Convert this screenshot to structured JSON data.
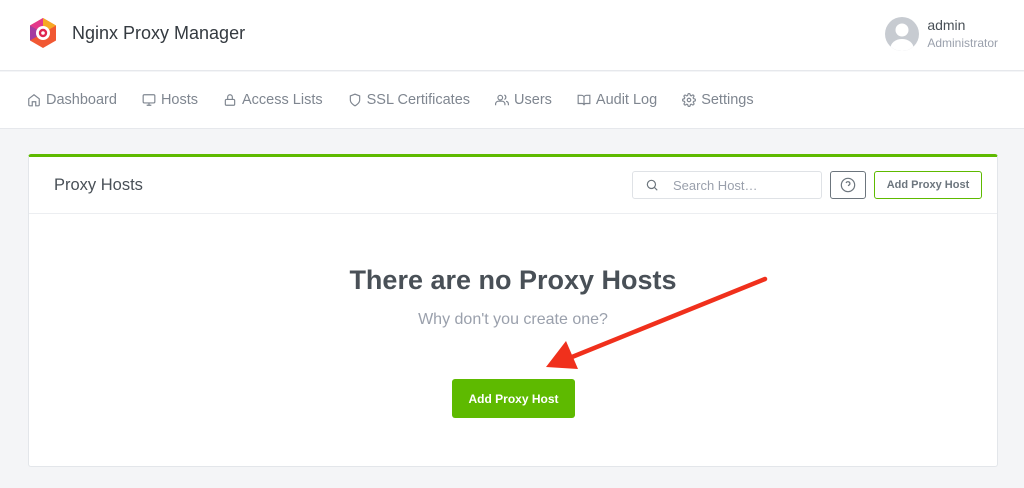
{
  "header": {
    "brand_title": "Nginx Proxy Manager",
    "user_name": "admin",
    "user_role": "Administrator"
  },
  "nav": {
    "items": [
      {
        "label": "Dashboard",
        "icon": "home-icon"
      },
      {
        "label": "Hosts",
        "icon": "monitor-icon"
      },
      {
        "label": "Access Lists",
        "icon": "lock-icon"
      },
      {
        "label": "SSL Certificates",
        "icon": "shield-icon"
      },
      {
        "label": "Users",
        "icon": "users-icon"
      },
      {
        "label": "Audit Log",
        "icon": "book-icon"
      },
      {
        "label": "Settings",
        "icon": "gear-icon"
      }
    ]
  },
  "card": {
    "title": "Proxy Hosts",
    "search_placeholder": "Search Host…",
    "add_outline_label": "Add Proxy Host",
    "empty_title": "There are no Proxy Hosts",
    "empty_subtitle": "Why don't you create one?",
    "add_primary_label": "Add Proxy Host"
  },
  "colors": {
    "accent": "#5eba00",
    "annotation_arrow": "#f0301c"
  }
}
